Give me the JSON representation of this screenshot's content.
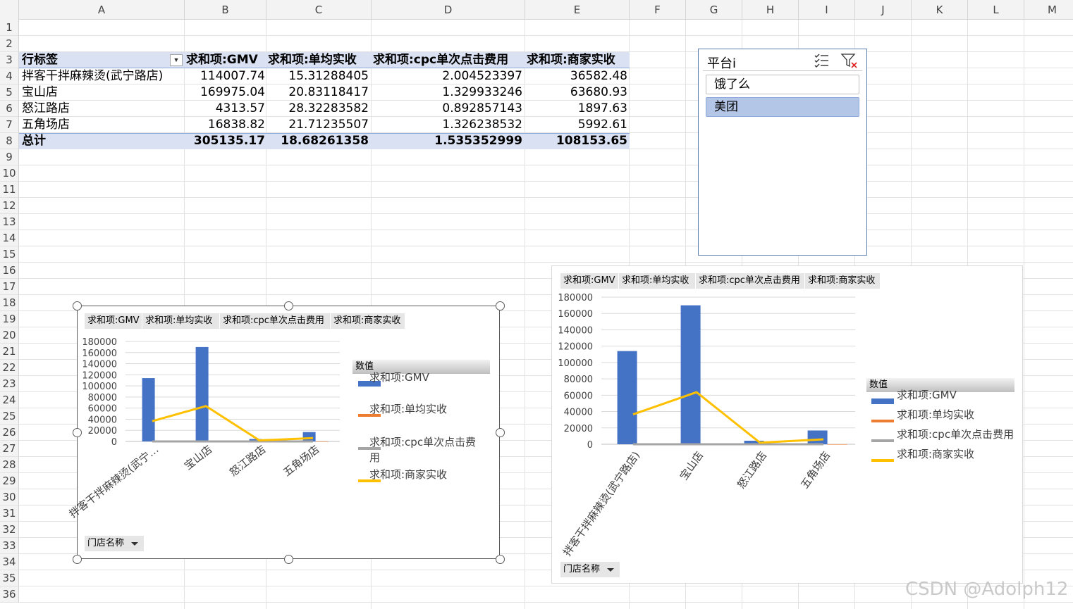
{
  "sheet": {
    "columns": [
      "A",
      "B",
      "C",
      "D",
      "E",
      "F",
      "G",
      "H",
      "I",
      "J",
      "K",
      "L",
      "M"
    ],
    "rows": [
      "1",
      "2",
      "3",
      "4",
      "5",
      "6",
      "7",
      "8",
      "9",
      "10",
      "11",
      "12",
      "13",
      "14",
      "15",
      "16",
      "17",
      "18",
      "19",
      "20",
      "21",
      "22",
      "23",
      "24",
      "25",
      "26",
      "27",
      "28",
      "29",
      "30",
      "31",
      "32",
      "33",
      "34",
      "35",
      "36"
    ]
  },
  "pivot": {
    "headers": [
      "行标签",
      "求和项:GMV",
      "求和项:单均实收",
      "求和项:cpc单次点击费用",
      "求和项:商家实收"
    ],
    "rows": [
      [
        "拌客干拌麻辣烫(武宁路店)",
        "114007.74",
        "15.31288405",
        "2.004523397",
        "36582.48"
      ],
      [
        "宝山店",
        "169975.04",
        "20.83118417",
        "1.329933246",
        "63680.93"
      ],
      [
        "怒江路店",
        "4313.57",
        "28.32283582",
        "0.892857143",
        "1897.63"
      ],
      [
        "五角场店",
        "16838.82",
        "21.71235507",
        "1.326238532",
        "5992.61"
      ]
    ],
    "total": [
      "总计",
      "305135.17",
      "18.68261358",
      "1.535352999",
      "108153.65"
    ]
  },
  "slicer": {
    "title": "平台i",
    "items": [
      {
        "label": "饿了么",
        "selected": false
      },
      {
        "label": "美团",
        "selected": true
      }
    ]
  },
  "chart_data": [
    {
      "type": "bar",
      "field_buttons": [
        "求和项:GMV",
        "求和项:单均实收",
        "求和项:cpc单次点击费用",
        "求和项:商家实收"
      ],
      "axis_field_button": "门店名称",
      "legend_title": "数值",
      "legend_entries": [
        "求和项:GMV",
        "求和项:单均实收",
        "求和项:cpc单次点击费",
        "用",
        "求和项:商家实收"
      ],
      "categories": [
        "拌客干拌麻辣烫(武宁…",
        "宝山店",
        "怒江路店",
        "五角场店"
      ],
      "yticks": [
        "0",
        "20000",
        "40000",
        "60000",
        "80000",
        "100000",
        "120000",
        "140000",
        "160000",
        "180000"
      ],
      "ylim": [
        0,
        180000
      ],
      "series": [
        {
          "name": "求和项:GMV",
          "kind": "bar",
          "color": "#4472c4",
          "values": [
            114007.74,
            169975.04,
            4313.57,
            16838.82
          ]
        },
        {
          "name": "求和项:单均实收",
          "kind": "bar",
          "color": "#ed7d31",
          "values": [
            15.31288405,
            20.83118417,
            28.32283582,
            21.71235507
          ]
        },
        {
          "name": "求和项:cpc单次点击费用",
          "kind": "line",
          "color": "#a5a5a5",
          "values": [
            2.004523397,
            1.329933246,
            0.892857143,
            1.326238532
          ]
        },
        {
          "name": "求和项:商家实收",
          "kind": "line",
          "color": "#ffc000",
          "values": [
            36582.48,
            63680.93,
            1897.63,
            5992.61
          ]
        }
      ]
    },
    {
      "type": "bar",
      "field_buttons": [
        "求和项:GMV",
        "求和项:单均实收",
        "求和项:cpc单次点击费用",
        "求和项:商家实收"
      ],
      "axis_field_button": "门店名称",
      "legend_title": "数值",
      "legend_entries": [
        "求和项:GMV",
        "求和项:单均实收",
        "求和项:cpc单次点击费用",
        "求和项:商家实收"
      ],
      "categories": [
        "拌客干拌麻辣烫(武宁路店)",
        "宝山店",
        "怒江路店",
        "五角场店"
      ],
      "yticks": [
        "0",
        "20000",
        "40000",
        "60000",
        "80000",
        "100000",
        "120000",
        "140000",
        "160000",
        "180000"
      ],
      "ylim": [
        0,
        180000
      ],
      "series": [
        {
          "name": "求和项:GMV",
          "kind": "bar",
          "color": "#4472c4",
          "values": [
            114007.74,
            169975.04,
            4313.57,
            16838.82
          ]
        },
        {
          "name": "求和项:单均实收",
          "kind": "bar",
          "color": "#ed7d31",
          "values": [
            15.31288405,
            20.83118417,
            28.32283582,
            21.71235507
          ]
        },
        {
          "name": "求和项:cpc单次点击费用",
          "kind": "line",
          "color": "#a5a5a5",
          "values": [
            2.004523397,
            1.329933246,
            0.892857143,
            1.326238532
          ]
        },
        {
          "name": "求和项:商家实收",
          "kind": "line",
          "color": "#ffc000",
          "values": [
            36582.48,
            63680.93,
            1897.63,
            5992.61
          ]
        }
      ]
    }
  ],
  "watermark": "CSDN @Adolph12"
}
